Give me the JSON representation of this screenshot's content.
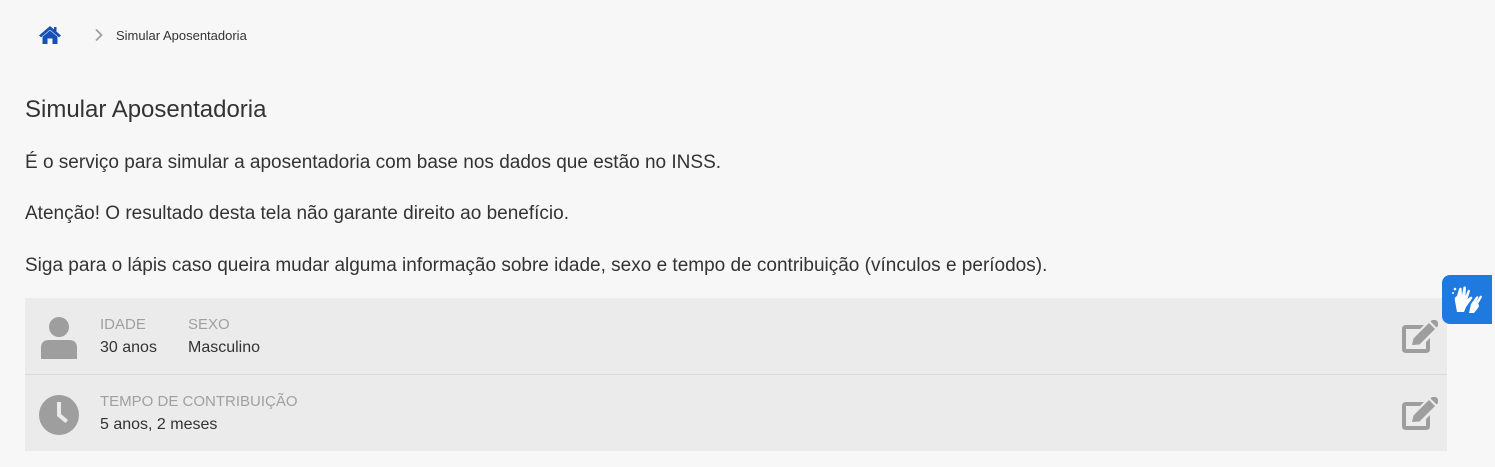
{
  "breadcrumb": {
    "home_icon": "home-icon",
    "separator_icon": "chevron-right-icon",
    "current": "Simular Aposentadoria"
  },
  "page": {
    "title": "Simular Aposentadoria",
    "paragraphs": [
      "É o serviço para simular a aposentadoria com base nos dados que estão no INSS.",
      "Atenção! O resultado desta tela não garante direito ao benefício.",
      "Siga para o lápis caso queira mudar alguma informação sobre idade, sexo e tempo de contribuição (vínculos e períodos)."
    ]
  },
  "personal_card": {
    "icon": "user-icon",
    "age_label": "IDADE",
    "age_value": "30 anos",
    "sex_label": "SEXO",
    "sex_value": "Masculino",
    "edit_icon": "edit-icon"
  },
  "contribution_card": {
    "icon": "clock-icon",
    "time_label": "TEMPO DE CONTRIBUIÇÃO",
    "time_value": "5 anos, 2 meses",
    "edit_icon": "edit-icon"
  },
  "accessibility_widget": {
    "icon": "sign-language-hands-icon"
  },
  "colors": {
    "background": "#f7f7f7",
    "card": "#ebebeb",
    "home_icon": "#1351b4",
    "widget": "#1f7ae0",
    "icon_gray": "#9e9e9e",
    "label_gray": "#a0a0a0"
  }
}
